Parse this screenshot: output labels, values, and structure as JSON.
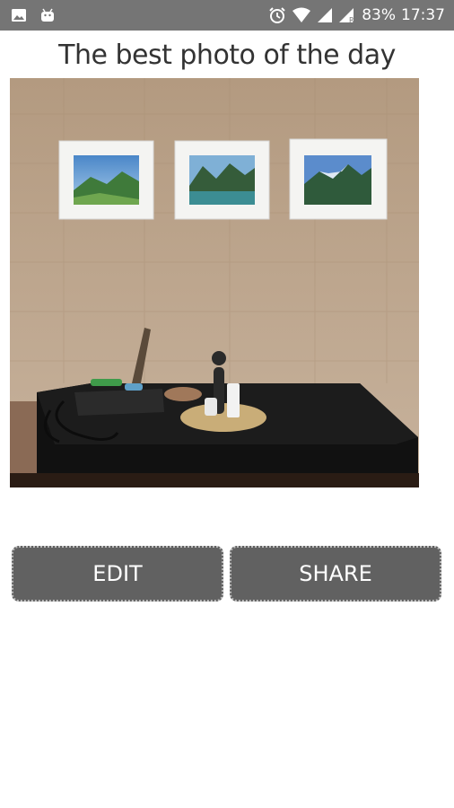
{
  "status_bar": {
    "battery": "83%",
    "time": "17:37",
    "icons": [
      "image-icon",
      "android-icon",
      "alarm-icon",
      "wifi-icon",
      "signal-icon",
      "roaming-signal-icon",
      "battery-icon"
    ]
  },
  "header": {
    "title": "The best photo of the day"
  },
  "photo": {
    "description_icon": "photo-image"
  },
  "actions": {
    "edit_label": "EDIT",
    "share_label": "SHARE"
  },
  "colors": {
    "status_bar": "#757575",
    "button_bg": "#616161",
    "button_text": "#ffffff"
  }
}
